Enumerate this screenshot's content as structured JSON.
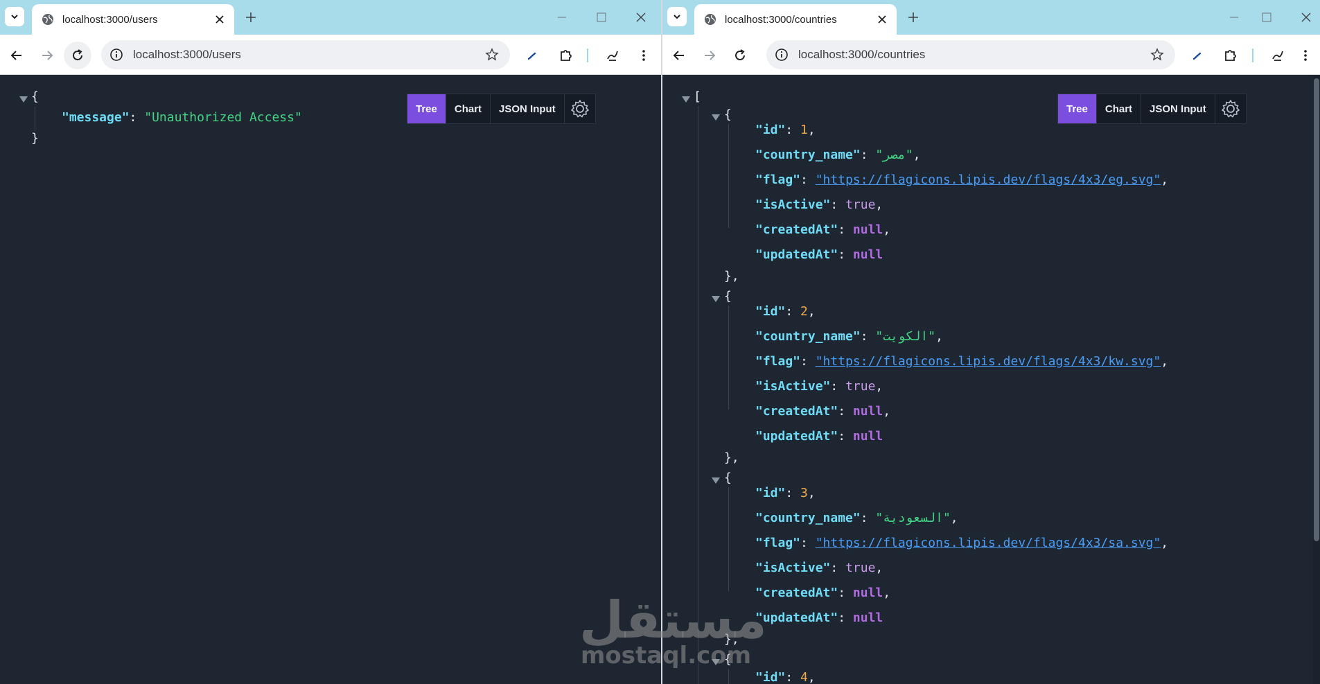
{
  "left": {
    "tab_title": "localhost:3000/users",
    "url": "localhost:3000/users",
    "json": {
      "open_brace": "{",
      "close_brace": "}",
      "message_key": "\"message\"",
      "message_value": "\"Unauthorized Access\""
    }
  },
  "right": {
    "tab_title": "localhost:3000/countries",
    "url": "localhost:3000/countries",
    "json": {
      "open_bracket": "[",
      "items": [
        {
          "id": "1",
          "country_name": "\"مصر\"",
          "flag": "\"https://flagicons.lipis.dev/flags/4x3/eg.svg\"",
          "isActive": "true",
          "createdAt": "null",
          "updatedAt": "null"
        },
        {
          "id": "2",
          "country_name": "\"الكويت\"",
          "flag": "\"https://flagicons.lipis.dev/flags/4x3/kw.svg\"",
          "isActive": "true",
          "createdAt": "null",
          "updatedAt": "null"
        },
        {
          "id": "3",
          "country_name": "\"السعودية\"",
          "flag": "\"https://flagicons.lipis.dev/flags/4x3/sa.svg\"",
          "isActive": "true",
          "createdAt": "null",
          "updatedAt": "null"
        },
        {
          "id": "4"
        }
      ]
    }
  },
  "keys": {
    "id": "\"id\"",
    "country_name": "\"country_name\"",
    "flag": "\"flag\"",
    "isActive": "\"isActive\"",
    "createdAt": "\"createdAt\"",
    "updatedAt": "\"updatedAt\""
  },
  "viewer": {
    "tree": "Tree",
    "chart": "Chart",
    "json_input": "JSON Input"
  },
  "watermark": {
    "arabic": "مستقل",
    "latin": "mostaql.com"
  },
  "colors": {
    "accent": "#7b4ee0",
    "background": "#1e2632",
    "tabstrip": "#a8dcea"
  }
}
